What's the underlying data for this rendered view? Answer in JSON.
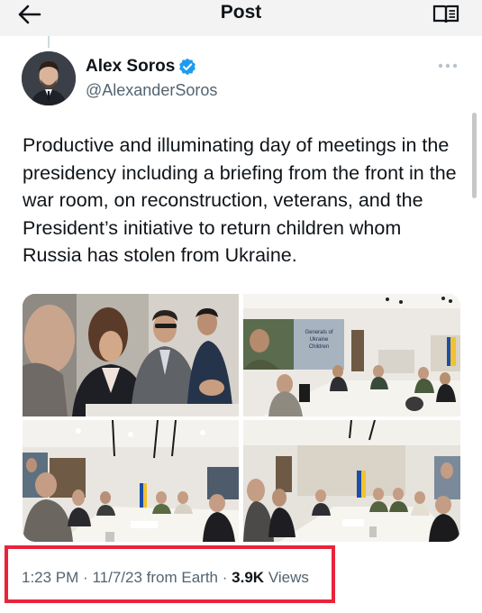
{
  "header": {
    "title": "Post",
    "back_icon": "arrow-left-icon",
    "reader_icon": "open-book-icon"
  },
  "author": {
    "name": "Alex Soros",
    "handle": "@AlexanderSoros",
    "verified": true,
    "verified_color": "#1d9bf0"
  },
  "tweet": {
    "text": "Productive and illuminating day of meetings in the presidency including a briefing from the front in the war room, on reconstruction, veterans, and the President’s initiative to return children whom Russia has stolen from Ukraine."
  },
  "media": {
    "photo_count": 4,
    "screen_caption_lines": [
      "Generals of",
      "Ukraine",
      "Children"
    ]
  },
  "meta": {
    "time": "1:23 PM",
    "date": "11/7/23",
    "source": "from Earth",
    "separator": "·",
    "views_count": "3.9K",
    "views_label": "Views",
    "highlight_color": "#e8243b"
  }
}
